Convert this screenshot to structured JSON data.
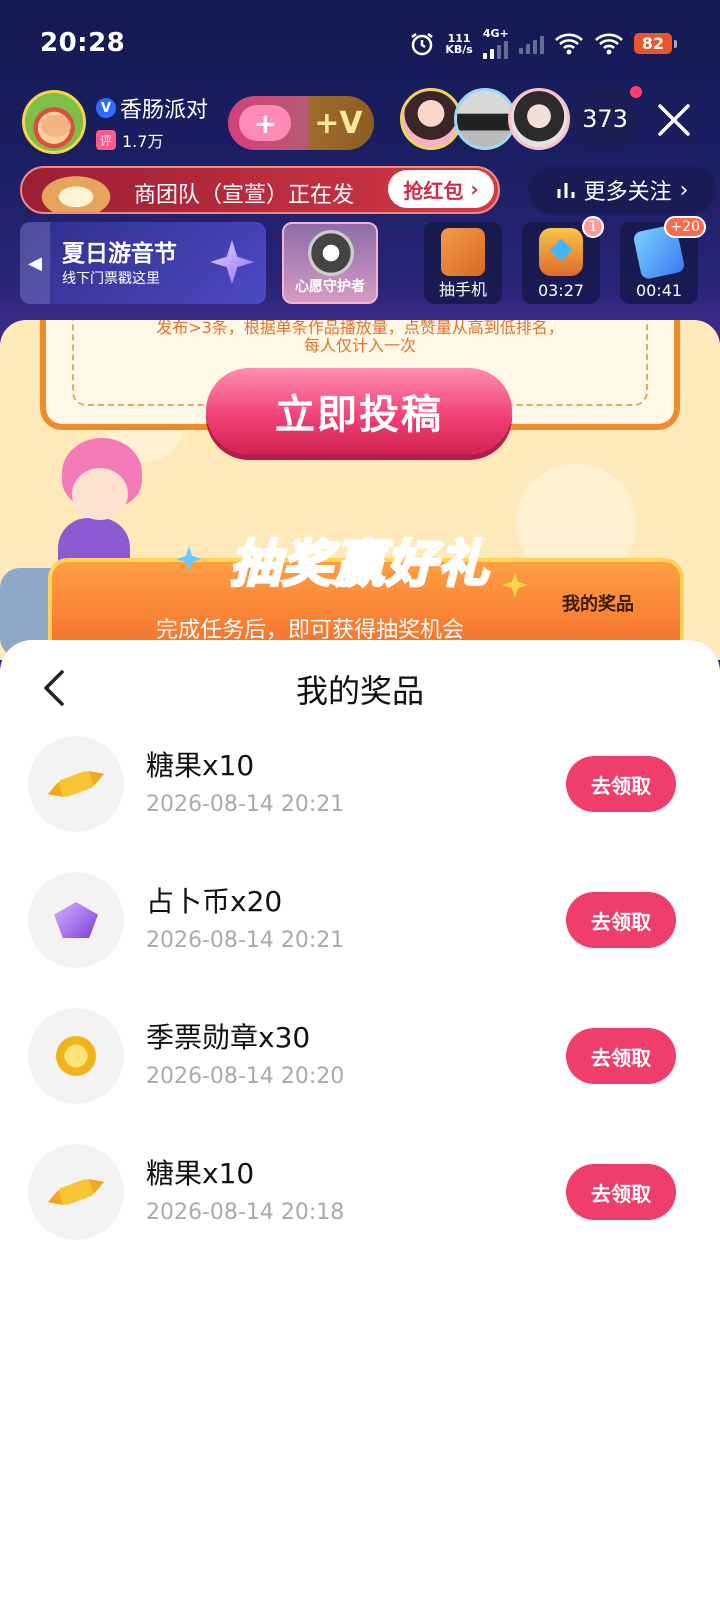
{
  "status_bar": {
    "time": "20:28",
    "net_speed": "111",
    "net_unit": "KB/s",
    "network": "4G+",
    "battery": "82"
  },
  "live_header": {
    "anchor_name": "香肠派对",
    "verified_badge": "V",
    "rating_badge": "评",
    "followers": "1.7万",
    "follow_plus": "+",
    "follow_v": "+V",
    "viewer_count": "373"
  },
  "banner": {
    "text": "商团队（宣萱）正在发",
    "red_packet_button": "抢红包",
    "more_follow": "更多关注"
  },
  "activities": {
    "festival_title": "夏日游音节",
    "festival_sub": "线下门票戳这里",
    "wish_label": "心愿守护者",
    "phone_label": "抽手机",
    "chest_badge": "1",
    "chest_timer": "03:27",
    "ticket_badge": "+20",
    "ticket_timer": "00:41"
  },
  "event_page": {
    "rule_line1": "发布>3条，根据单条作品播放量，点赞量从高到低排名，",
    "rule_line2": "每人仅计入一次",
    "submit_button": "立即投稿",
    "lottery_title": "抽奖赢好礼",
    "lottery_sub": "完成任务后，即可获得抽奖机会",
    "my_prizes_link": "我的奖品"
  },
  "sheet": {
    "title": "我的奖品",
    "prizes": [
      {
        "name": "糖果x10",
        "date": "2026-08-14 20:21",
        "icon": "candy-icon",
        "action": "去领取"
      },
      {
        "name": "占卜币x20",
        "date": "2026-08-14 20:21",
        "icon": "divination-coin-icon",
        "action": "去领取"
      },
      {
        "name": "季票勋章x30",
        "date": "2026-08-14 20:20",
        "icon": "season-medal-icon",
        "action": "去领取"
      },
      {
        "name": "糖果x10",
        "date": "2026-08-14 20:18",
        "icon": "candy-icon",
        "action": "去领取"
      }
    ]
  },
  "colors": {
    "accent_pink": "#ef3e6b",
    "header_bg": "#1b1f63",
    "event_bg": "#fde9b9"
  }
}
